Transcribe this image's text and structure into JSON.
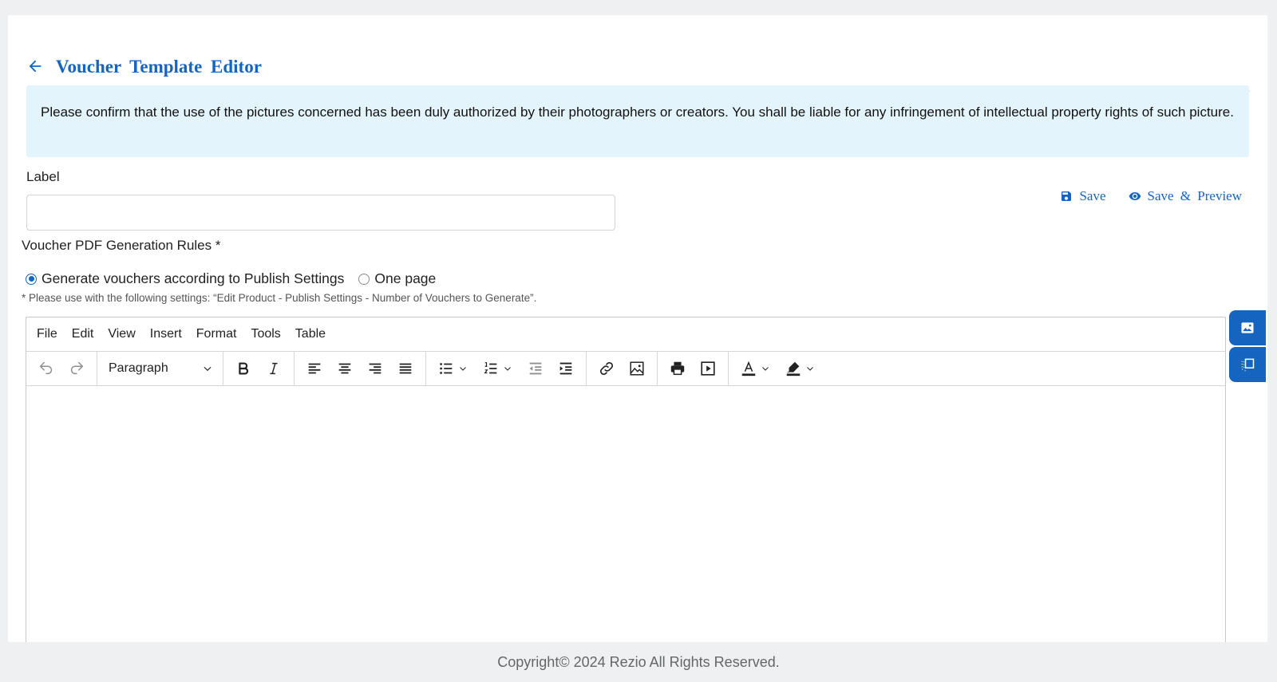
{
  "header": {
    "title": "Voucher Template Editor",
    "back_icon": "arrow-left-icon"
  },
  "notice": {
    "text": "Please confirm that the use of the pictures concerned has been duly authorized by their photographers or creators. You shall be liable for any infringement of intellectual property rights of such picture."
  },
  "label_field": {
    "label": "Label",
    "value": "",
    "placeholder": ""
  },
  "actions": {
    "save": "Save",
    "save_preview": "Save & Preview"
  },
  "rules": {
    "title": "Voucher PDF Generation Rules *",
    "options": [
      "Generate vouchers according to Publish Settings",
      "One page"
    ],
    "selected": "Generate vouchers according to Publish Settings",
    "hint": "* Please use with the following settings: “Edit Product - Publish Settings - Number of Vouchers to Generate”."
  },
  "editor": {
    "menu": [
      "File",
      "Edit",
      "View",
      "Insert",
      "Format",
      "Tools",
      "Table"
    ],
    "block_format": "Paragraph"
  },
  "colors": {
    "accent": "#1565c0",
    "notice_bg": "#e4f4fd",
    "page_bg": "#eff0f2"
  },
  "footer": {
    "text": "Copyright© 2024 Rezio All Rights Reserved."
  }
}
